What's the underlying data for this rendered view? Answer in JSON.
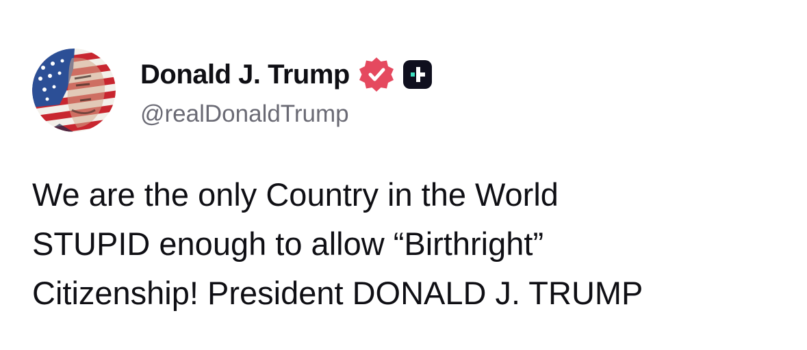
{
  "post": {
    "author": {
      "display_name": "Donald J. Trump",
      "handle": "@realDonaldTrump",
      "avatar": "profile-avatar-flag-portrait",
      "verified_icon": "verified-badge-icon",
      "verified_color": "#e5495f",
      "extra_badge_icon": "plus-badge-icon",
      "extra_badge_color": "#0f0f1e",
      "extra_badge_accent": "#3ee0c0"
    },
    "text_lines": [
      "We are the only Country in the World",
      "STUPID enough to allow “Birthright”",
      "Citizenship! President DONALD J. TRUMP"
    ]
  }
}
